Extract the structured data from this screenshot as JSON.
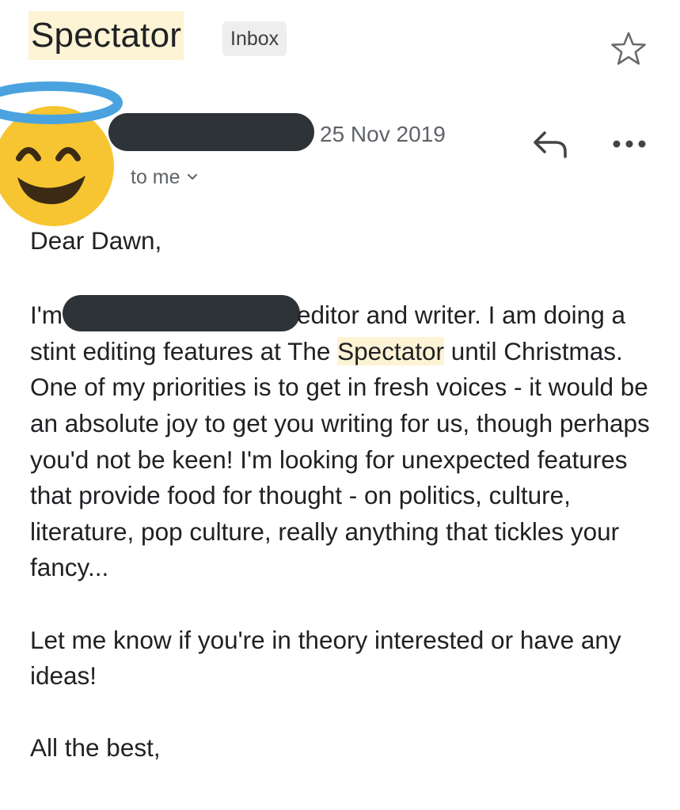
{
  "header": {
    "subject": "Spectator",
    "label": "Inbox",
    "star_icon": "star-outline-icon"
  },
  "message": {
    "avatar_icon": "smiling-face-with-halo-emoji",
    "date": "25 Nov 2019",
    "recipient": "to me",
    "reply_icon": "reply-icon",
    "more_icon": "more-horizontal-icon",
    "body": {
      "greeting": "Dear Dawn,",
      "p1_start": "I'm",
      "p1_after_redaction": "editor and writer. I am doing a stint editing features at The ",
      "p1_highlight": "Spectator",
      "p1_end": " until Christmas.  One of my priorities is to get in fresh voices - it would be an absolute joy to get you writing for us, though perhaps you'd not be keen! I'm looking for unexpected features that provide food for thought - on politics, culture, literature, pop culture, really anything that tickles your fancy...",
      "p2": "Let me know if you're in theory interested or have any ideas!",
      "closing": "All the best,"
    }
  },
  "colors": {
    "highlight": "#fdf3d5",
    "redaction": "#2e3337",
    "chip_bg": "#eeeeee",
    "halo": "#4aa3df",
    "face": "#f7c531"
  }
}
